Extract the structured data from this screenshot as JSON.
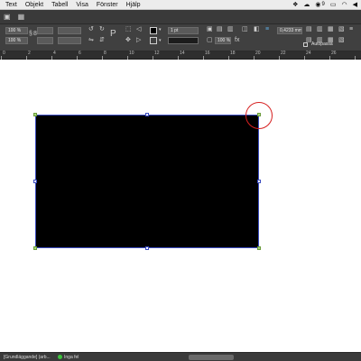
{
  "menubar": {
    "items": [
      "Text",
      "Objekt",
      "Tabell",
      "Visa",
      "Fönster",
      "Hjälp"
    ],
    "status": {
      "notification_count": "9"
    }
  },
  "control": {
    "scale_x": "100 %",
    "scale_y": "100 %",
    "stroke_weight": "1 pt",
    "offset": "0,4233 mm",
    "opacity": "100 %",
    "autofit_label": "Autopassa"
  },
  "ruler": {
    "ticks": [
      "0",
      "2",
      "4",
      "6",
      "8",
      "10",
      "12",
      "14",
      "16",
      "18",
      "20",
      "22",
      "24",
      "26"
    ]
  },
  "statusbar": {
    "page": "[Grundläggande] (arb...",
    "errors": "Inga fel"
  },
  "colors": {
    "ui_dark": "#3a3a3a",
    "selection": "#3b4cc0",
    "shape_fill": "#000000",
    "highlight": "#d62020",
    "ok_status": "#3cc23c"
  }
}
